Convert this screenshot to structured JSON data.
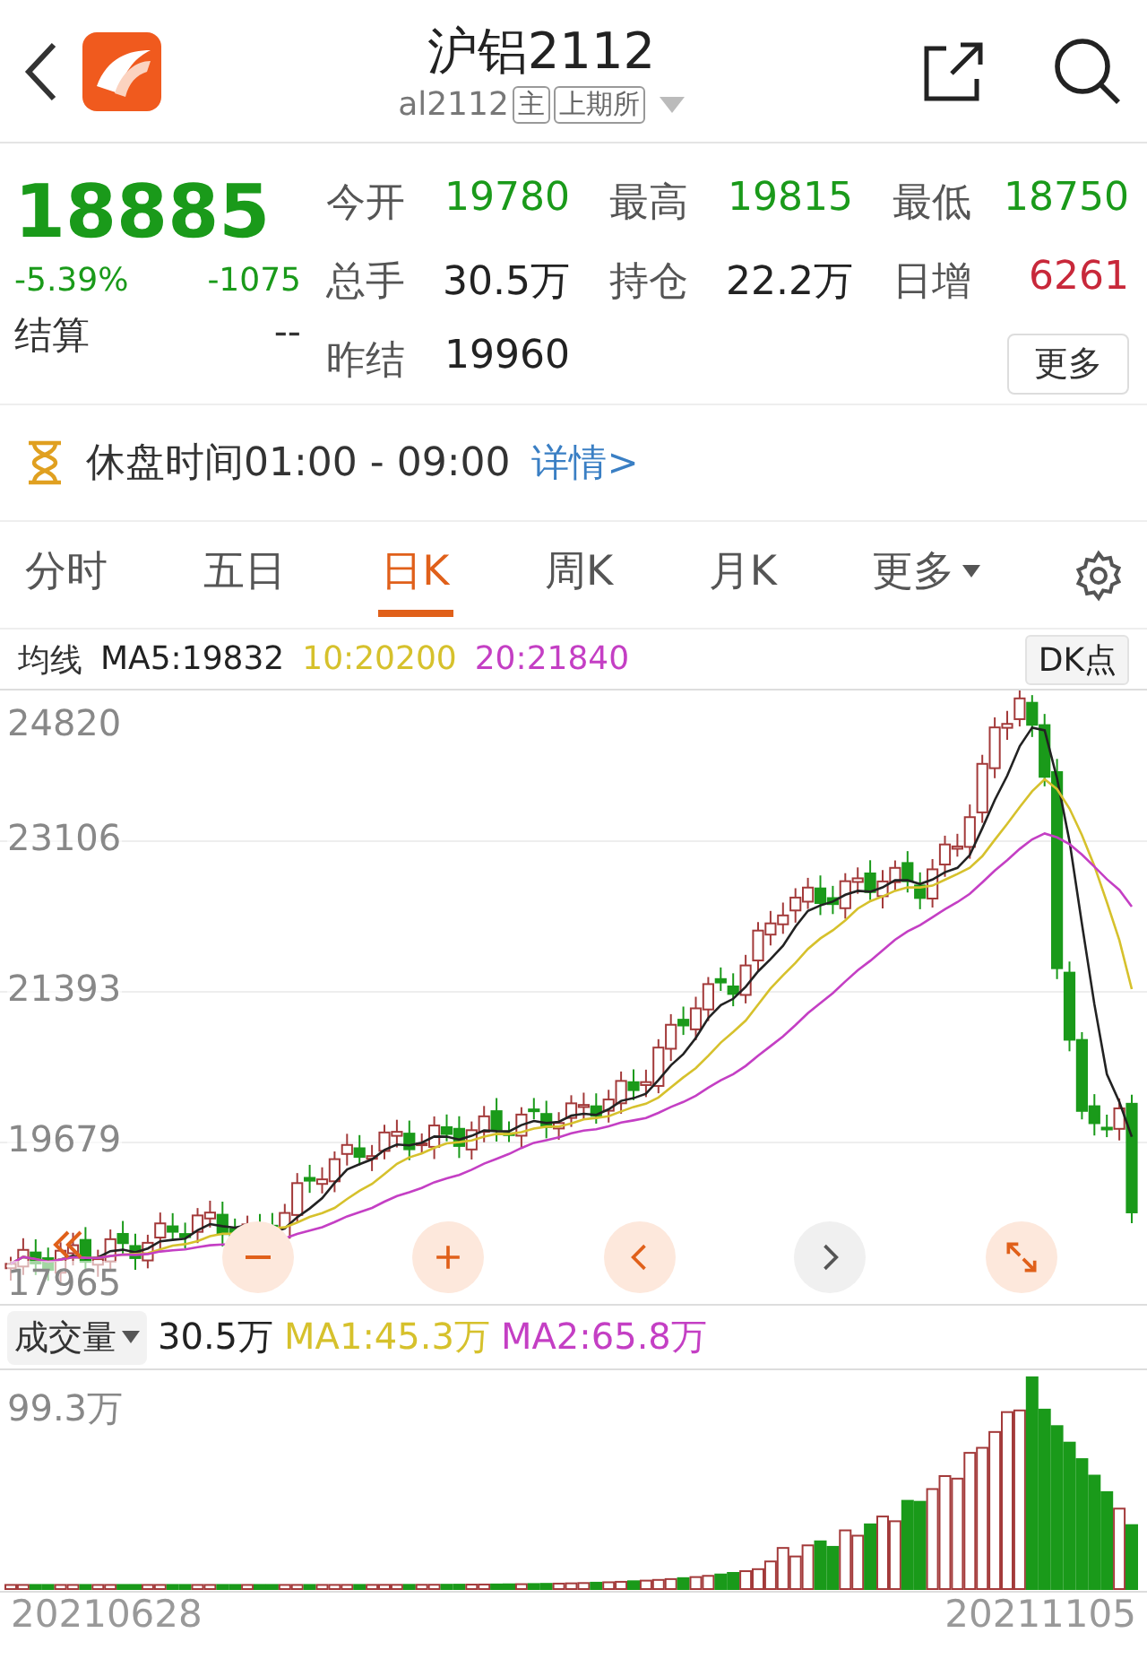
{
  "header": {
    "title": "沪铝2112",
    "code": "al2112",
    "tags": [
      "主",
      "上期所"
    ]
  },
  "quote": {
    "price": "18885",
    "change_pct": "-5.39%",
    "change": "-1075",
    "settle_label": "结算",
    "settle_value": "--",
    "more_button": "更多",
    "stats": [
      {
        "label": "今开",
        "value": "19780",
        "kind": "down"
      },
      {
        "label": "最高",
        "value": "19815",
        "kind": "down"
      },
      {
        "label": "最低",
        "value": "18750",
        "kind": "down"
      },
      {
        "label": "总手",
        "value": "30.5万",
        "kind": "flat"
      },
      {
        "label": "持仓",
        "value": "22.2万",
        "kind": "flat"
      },
      {
        "label": "日增",
        "value": "6261",
        "kind": "up"
      },
      {
        "label": "昨结",
        "value": "19960",
        "kind": "flat"
      }
    ]
  },
  "notice": {
    "text": "休盘时间01:00 - 09:00",
    "link": "详情>"
  },
  "tabs": [
    {
      "label": "分时",
      "selected": false,
      "dropdown": false
    },
    {
      "label": "五日",
      "selected": false,
      "dropdown": false
    },
    {
      "label": "日K",
      "selected": true,
      "dropdown": false
    },
    {
      "label": "周K",
      "selected": false,
      "dropdown": false
    },
    {
      "label": "月K",
      "selected": false,
      "dropdown": false
    },
    {
      "label": "更多",
      "selected": false,
      "dropdown": true
    }
  ],
  "ma_bar": {
    "label": "均线",
    "items": [
      {
        "text": "MA5:19832",
        "color": "#222222"
      },
      {
        "text": "10:20200",
        "color": "#d6c12c"
      },
      {
        "text": "20:21840",
        "color": "#c43fc4"
      }
    ],
    "button": "DK点"
  },
  "price_axis": [
    "24820",
    "23106",
    "21393",
    "19679",
    "17965"
  ],
  "volume": {
    "selector": "成交量",
    "value": "30.5万",
    "items": [
      {
        "text": "MA1:45.3万",
        "color": "#d6c12c"
      },
      {
        "text": "MA2:65.8万",
        "color": "#c43fc4"
      }
    ],
    "axis_label": "99.3万",
    "start_date": "20210628",
    "end_date": "20211105"
  }
}
